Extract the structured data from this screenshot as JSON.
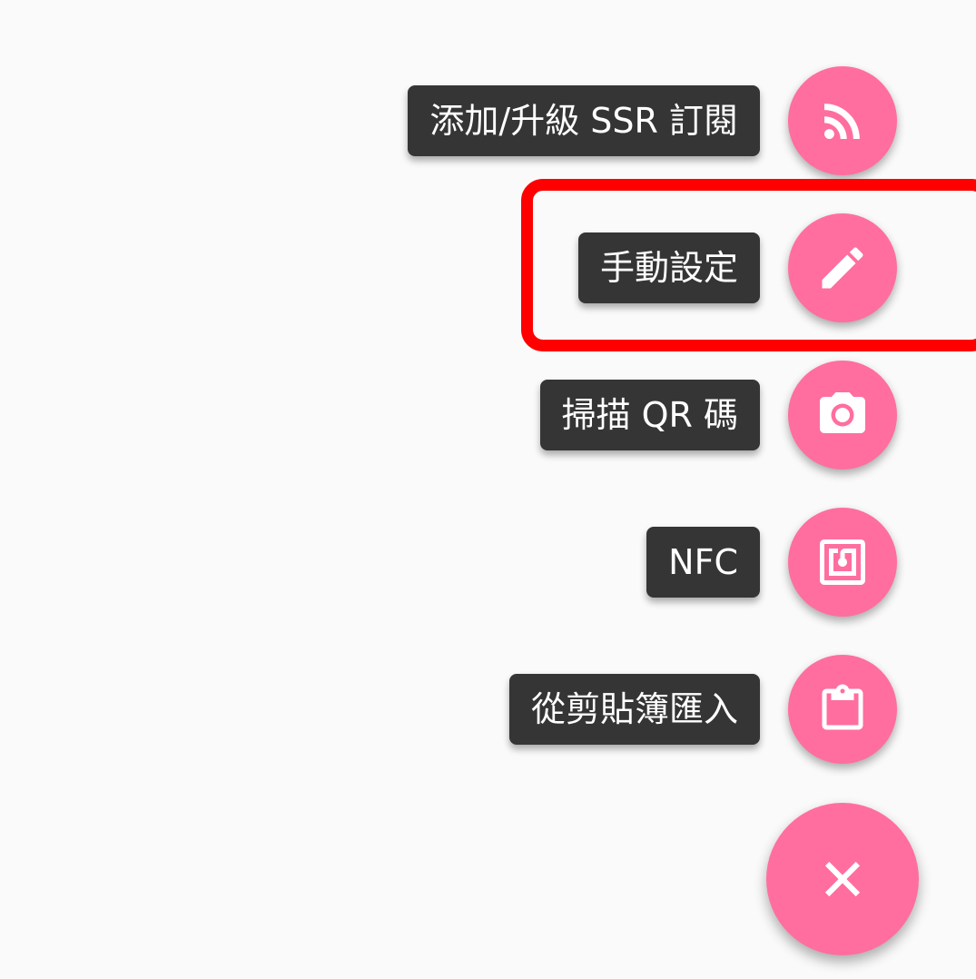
{
  "fab_menu": {
    "items": [
      {
        "label": "添加/升級 SSR 訂閱",
        "icon": "rss-feed-icon"
      },
      {
        "label": "手動設定",
        "icon": "pencil-icon"
      },
      {
        "label": "掃描 QR 碼",
        "icon": "camera-icon"
      },
      {
        "label": "NFC",
        "icon": "nfc-icon"
      },
      {
        "label": "從剪貼簿匯入",
        "icon": "clipboard-icon"
      }
    ],
    "close_icon": "close-icon"
  },
  "colors": {
    "fab_accent": "#ff6e9f",
    "label_background": "#353535",
    "label_text": "#ffffff",
    "highlight": "#ff0000",
    "page_background": "#fafafa"
  }
}
